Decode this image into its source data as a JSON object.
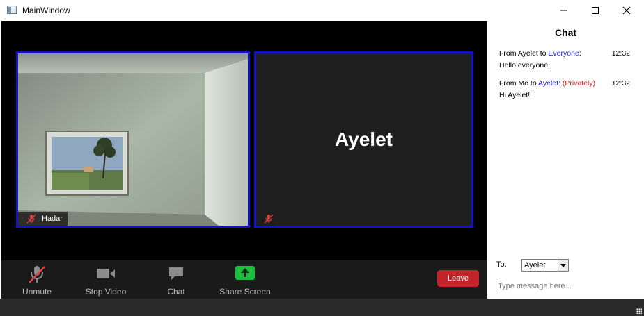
{
  "window": {
    "title": "MainWindow"
  },
  "video": {
    "tiles": [
      {
        "name": "Hadar",
        "muted": true,
        "video_on": true
      },
      {
        "name": "Ayelet",
        "muted": true,
        "video_on": false
      }
    ]
  },
  "toolbar": {
    "unmute_label": "Unmute",
    "stop_video_label": "Stop Video",
    "chat_label": "Chat",
    "share_screen_label": "Share Screen",
    "leave_label": "Leave"
  },
  "chat": {
    "title": "Chat",
    "messages": [
      {
        "prefix": "From Ayelet to ",
        "target": "Everyone",
        "suffix": ":",
        "private_label": "",
        "time": "12:32",
        "text": "Hello everyone!"
      },
      {
        "prefix": "From Me to ",
        "target": "Ayelet",
        "suffix": ":",
        "private_label": "(Privately)",
        "time": "12:32",
        "text": "Hi Ayelet!!!"
      }
    ],
    "to_label": "To:",
    "to_value": "Ayelet",
    "placeholder": "Type message here..."
  },
  "colors": {
    "tile_border": "#0f12c8",
    "recipient_blue": "#1a1ad6",
    "private_red": "#d42020",
    "leave_button": "#c2242a",
    "share_green": "#1bbd3a"
  }
}
